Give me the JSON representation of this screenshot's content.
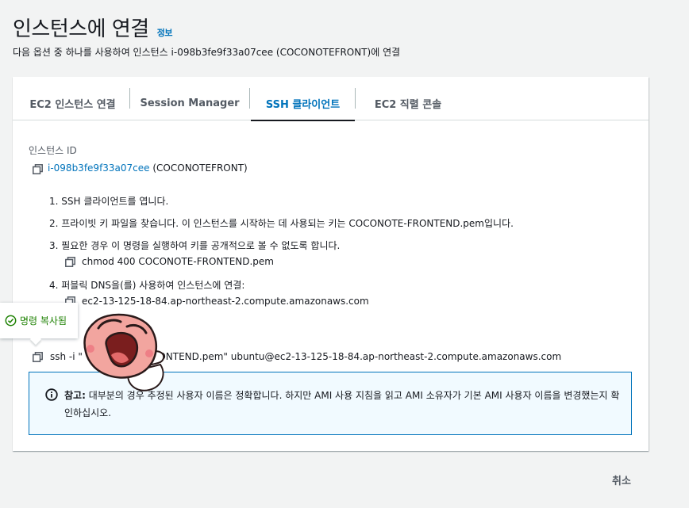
{
  "header": {
    "title": "인스턴스에 연결",
    "info_link": "정보",
    "subtitle": "다음 옵션 중 하나를 사용하여 인스턴스 i-098b3fe9f33a07cee (COCONOTEFRONT)에 연결"
  },
  "tabs": [
    {
      "label": "EC2 인스턴스 연결",
      "active": false
    },
    {
      "label": "Session Manager",
      "active": false
    },
    {
      "label": "SSH 클라이언트",
      "active": true
    },
    {
      "label": "EC2 직렬 콘솔",
      "active": false
    }
  ],
  "instance": {
    "label": "인스턴스 ID",
    "id": "i-098b3fe9f33a07cee",
    "name": "(COCONOTEFRONT)"
  },
  "steps": [
    {
      "text": "1. SSH 클라이언트를 엽니다."
    },
    {
      "text": "2. 프라이빗 키 파일을 찾습니다. 이 인스턴스를 시작하는 데 사용되는 키는 COCONOTE-FRONTEND.pem입니다."
    },
    {
      "text": "3. 필요한 경우 이 명령을 실행하여 키를 공개적으로 볼 수 없도록 합니다.",
      "command": "chmod 400 COCONOTE-FRONTEND.pem"
    },
    {
      "text": "4. 퍼블릭 DNS을(를) 사용하여 인스턴스에 연결:",
      "command": "ec2-13-125-18-84.ap-northeast-2.compute.amazonaws.com"
    }
  ],
  "ssh": {
    "command_start": "ssh -i \"",
    "command_end": "RONTEND.pem\" ubuntu@ec2-13-125-18-84.ap-northeast-2.compute.amazonaws.com"
  },
  "toast": {
    "label": "명령 복사됨"
  },
  "notice": {
    "bold": "참고:",
    "text": " 대부분의 경우 추정된 사용자 이름은 정확합니다. 하지만 AMI 사용 지침을 읽고 AMI 소유자가 기본 AMI 사용자 이름을 변경했는지 확인하십시오."
  },
  "footer": {
    "cancel_label": "취소"
  },
  "colors": {
    "accent": "#0073bb",
    "success": "#1d8102",
    "notice_bg": "#f1faff"
  },
  "icons": [
    "copy-icon",
    "info-icon",
    "check-circle-icon"
  ]
}
